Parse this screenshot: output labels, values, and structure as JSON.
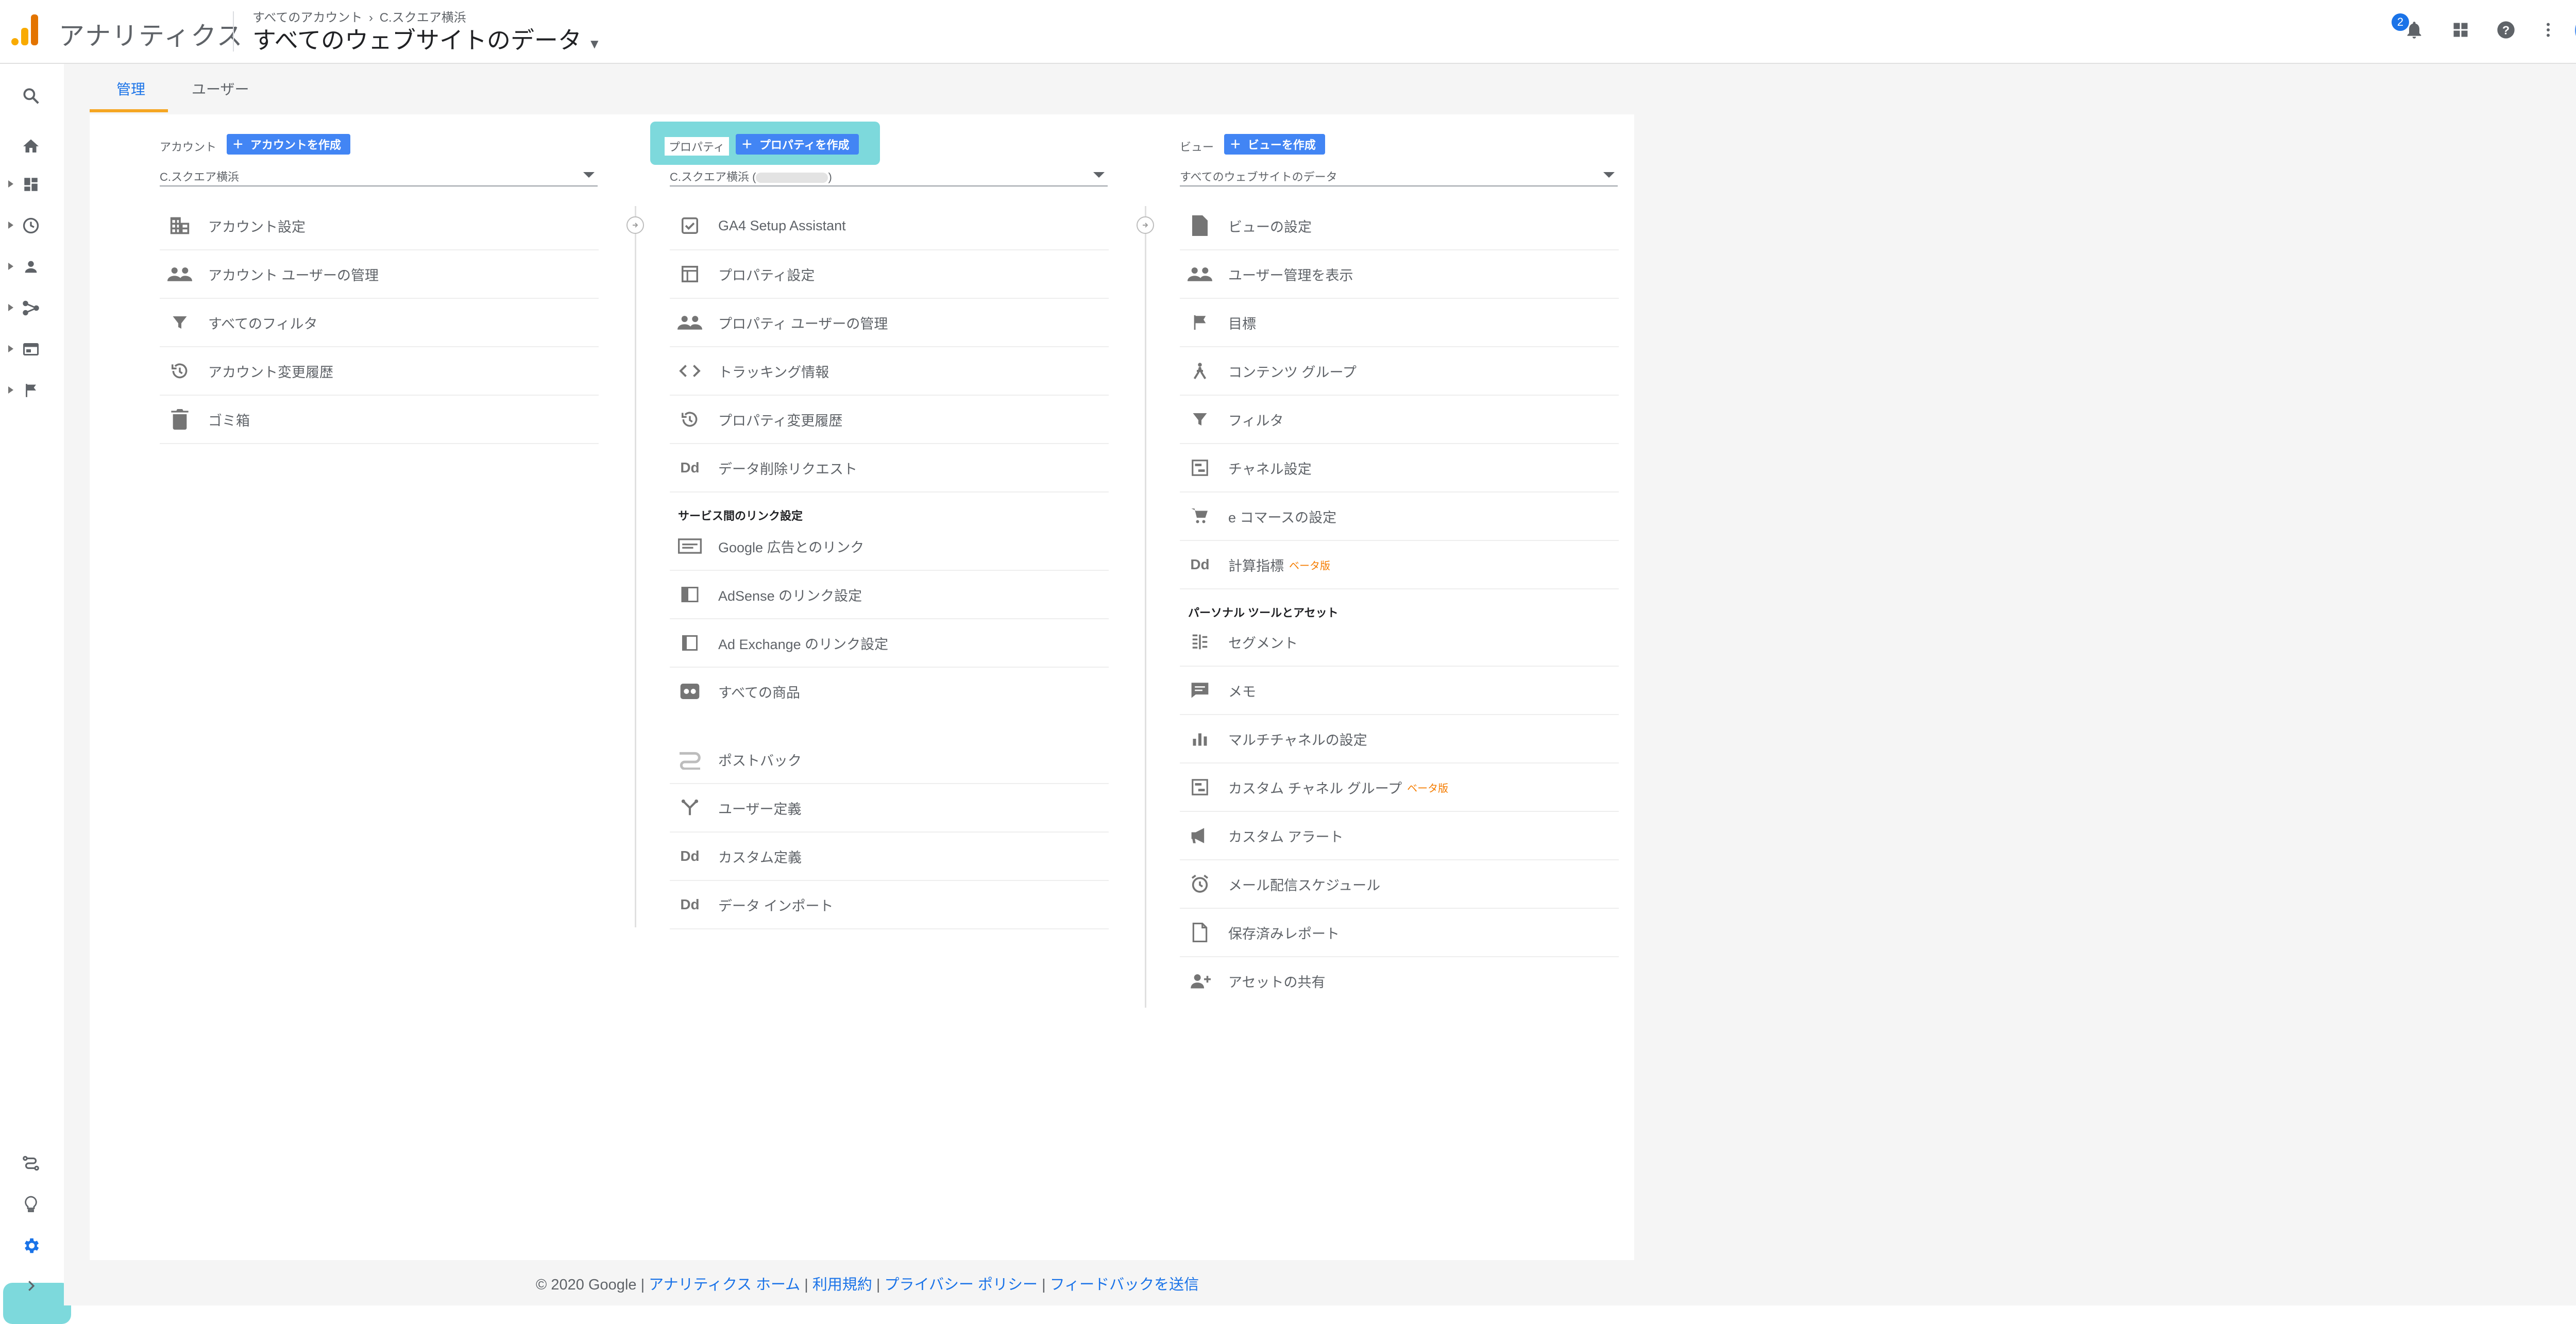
{
  "app": {
    "title": "アナリティクス"
  },
  "breadcrumb": {
    "part1": "すべてのアカウント",
    "sep": "›",
    "part2": "C.スクエア横浜"
  },
  "view_title": "すべてのウェブサイトのデータ",
  "header": {
    "notification_count": "2"
  },
  "tabs": [
    {
      "label": "管理"
    },
    {
      "label": "ユーザー"
    }
  ],
  "colors": {
    "accent": "#1a73e8",
    "button": "#4285f4",
    "highlight": "#7dd9dc",
    "tab_indicator": "#f5a623",
    "beta": "#f57c00"
  },
  "account": {
    "label": "アカウント",
    "create_label": "アカウントを作成",
    "selected": "C.スクエア横浜",
    "items": [
      {
        "label": "アカウント設定",
        "icon": "building-icon"
      },
      {
        "label": "アカウント ユーザーの管理",
        "icon": "people-icon"
      },
      {
        "label": "すべてのフィルタ",
        "icon": "filter-icon"
      },
      {
        "label": "アカウント変更履歴",
        "icon": "history-icon"
      },
      {
        "label": "ゴミ箱",
        "icon": "trash-icon"
      }
    ]
  },
  "property": {
    "label": "プロパティ",
    "create_label": "プロパティを作成",
    "selected_prefix": "C.スクエア横浜 (",
    "selected_suffix": ")",
    "items": [
      {
        "label": "GA4 Setup Assistant",
        "icon": "checkbox-icon"
      },
      {
        "label": "プロパティ設定",
        "icon": "property-settings-icon"
      },
      {
        "label": "プロパティ ユーザーの管理",
        "icon": "people-icon"
      },
      {
        "label": "トラッキング情報",
        "icon": "code-icon"
      },
      {
        "label": "プロパティ変更履歴",
        "icon": "history-icon"
      },
      {
        "label": "データ削除リクエスト",
        "icon": "dd-icon"
      }
    ],
    "links_section": "サービス間のリンク設定",
    "links": [
      {
        "label": "Google 広告とのリンク",
        "icon": "ads-icon"
      },
      {
        "label": "AdSense のリンク設定",
        "icon": "adsense-icon"
      },
      {
        "label": "Ad Exchange のリンク設定",
        "icon": "adexchange-icon"
      },
      {
        "label": "すべての商品",
        "icon": "products-icon"
      }
    ],
    "more": [
      {
        "label": "ポストバック",
        "icon": "postback-icon"
      },
      {
        "label": "ユーザー定義",
        "icon": "user-define-icon"
      },
      {
        "label": "カスタム定義",
        "icon": "dd-icon"
      },
      {
        "label": "データ インポート",
        "icon": "dd-icon"
      }
    ]
  },
  "view": {
    "label": "ビュー",
    "create_label": "ビューを作成",
    "selected": "すべてのウェブサイトのデータ",
    "items": [
      {
        "label": "ビューの設定",
        "icon": "document-icon"
      },
      {
        "label": "ユーザー管理を表示",
        "icon": "people-icon"
      },
      {
        "label": "目標",
        "icon": "flag-icon"
      },
      {
        "label": "コンテンツ グループ",
        "icon": "content-group-icon"
      },
      {
        "label": "フィルタ",
        "icon": "filter-icon"
      },
      {
        "label": "チャネル設定",
        "icon": "channel-icon"
      },
      {
        "label": "e コマースの設定",
        "icon": "cart-icon"
      },
      {
        "label": "計算指標",
        "icon": "dd-icon",
        "beta": "ベータ版"
      }
    ],
    "personal_section": "パーソナル ツールとアセット",
    "personal": [
      {
        "label": "セグメント",
        "icon": "segment-icon"
      },
      {
        "label": "メモ",
        "icon": "memo-icon"
      },
      {
        "label": "マルチチャネルの設定",
        "icon": "bar-chart-icon"
      },
      {
        "label": "カスタム チャネル グループ",
        "icon": "channel-icon",
        "beta": "ベータ版"
      },
      {
        "label": "カスタム アラート",
        "icon": "megaphone-icon"
      },
      {
        "label": "メール配信スケジュール",
        "icon": "clock-icon"
      },
      {
        "label": "保存済みレポート",
        "icon": "saved-report-icon"
      },
      {
        "label": "アセットの共有",
        "icon": "person-add-icon"
      }
    ]
  },
  "footer": {
    "copyright": "© 2020 Google |",
    "links": [
      "アナリティクス ホーム",
      "利用規約",
      "プライバシー ポリシー",
      "フィードバックを送信"
    ],
    "sep": "|"
  }
}
